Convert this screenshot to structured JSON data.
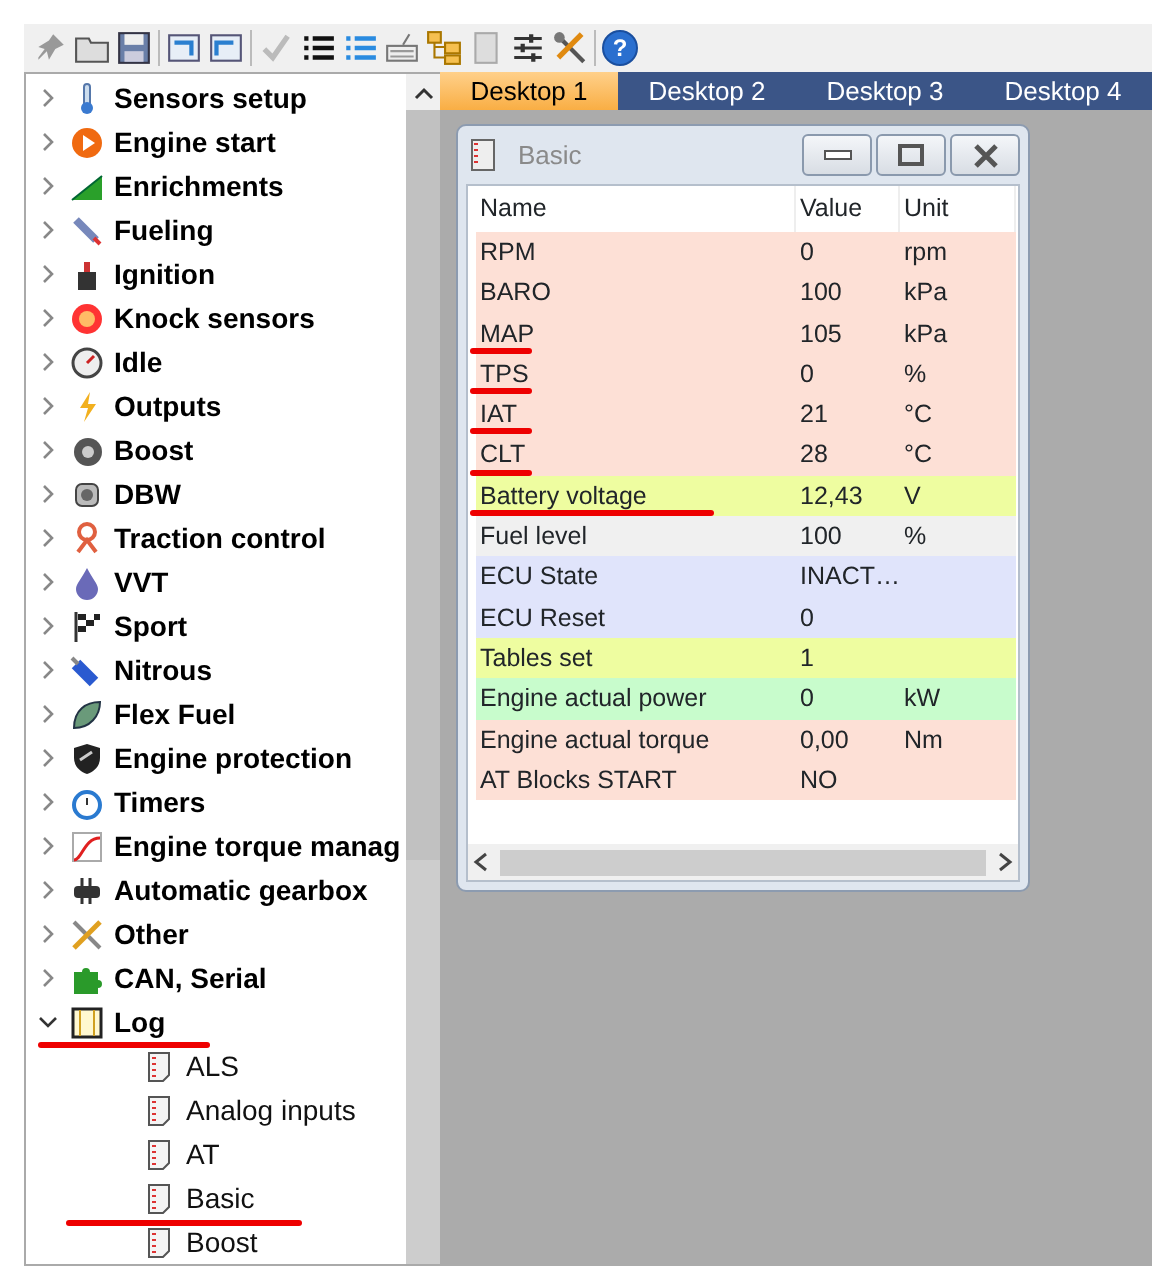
{
  "toolbar": {
    "help": "?"
  },
  "tabs": [
    {
      "label": "Desktop 1",
      "selected": true
    },
    {
      "label": "Desktop 2",
      "selected": false
    },
    {
      "label": "Desktop 3",
      "selected": false
    },
    {
      "label": "Desktop 4",
      "selected": false
    }
  ],
  "tree": [
    {
      "label": "Sensors setup",
      "expanded": false,
      "underlined": false
    },
    {
      "label": "Engine start",
      "expanded": false,
      "underlined": false
    },
    {
      "label": "Enrichments",
      "expanded": false,
      "underlined": false
    },
    {
      "label": "Fueling",
      "expanded": false,
      "underlined": false
    },
    {
      "label": "Ignition",
      "expanded": false,
      "underlined": false
    },
    {
      "label": "Knock sensors",
      "expanded": false,
      "underlined": false
    },
    {
      "label": "Idle",
      "expanded": false,
      "underlined": false
    },
    {
      "label": "Outputs",
      "expanded": false,
      "underlined": false
    },
    {
      "label": "Boost",
      "expanded": false,
      "underlined": false
    },
    {
      "label": "DBW",
      "expanded": false,
      "underlined": false
    },
    {
      "label": "Traction control",
      "expanded": false,
      "underlined": false
    },
    {
      "label": "VVT",
      "expanded": false,
      "underlined": false
    },
    {
      "label": "Sport",
      "expanded": false,
      "underlined": false
    },
    {
      "label": "Nitrous",
      "expanded": false,
      "underlined": false
    },
    {
      "label": "Flex Fuel",
      "expanded": false,
      "underlined": false
    },
    {
      "label": "Engine protection",
      "expanded": false,
      "underlined": false
    },
    {
      "label": "Timers",
      "expanded": false,
      "underlined": false
    },
    {
      "label": "Engine torque manag",
      "expanded": false,
      "underlined": false
    },
    {
      "label": "Automatic gearbox",
      "expanded": false,
      "underlined": false
    },
    {
      "label": "Other",
      "expanded": false,
      "underlined": false
    },
    {
      "label": "CAN, Serial",
      "expanded": false,
      "underlined": false
    },
    {
      "label": "Log",
      "expanded": true,
      "underlined": true,
      "children": [
        {
          "label": "ALS",
          "underlined": false
        },
        {
          "label": "Analog inputs",
          "underlined": false
        },
        {
          "label": "AT",
          "underlined": false
        },
        {
          "label": "Basic",
          "underlined": true
        },
        {
          "label": "Boost",
          "underlined": false
        }
      ]
    }
  ],
  "log_window": {
    "title": "Basic",
    "columns": [
      "Name",
      "Value",
      "Unit"
    ],
    "rows": [
      {
        "name": "RPM",
        "value": "0",
        "unit": "rpm",
        "color": "#fde0d6",
        "underlined": false
      },
      {
        "name": "BARO",
        "value": "100",
        "unit": "kPa",
        "color": "#fde0d6",
        "underlined": false
      },
      {
        "name": "MAP",
        "value": "105",
        "unit": "kPa",
        "color": "#fde0d6",
        "underlined": true
      },
      {
        "name": "TPS",
        "value": "0",
        "unit": "%",
        "color": "#fde0d6",
        "underlined": true
      },
      {
        "name": "IAT",
        "value": "21",
        "unit": "°C",
        "color": "#fde0d6",
        "underlined": true
      },
      {
        "name": "CLT",
        "value": "28",
        "unit": "°C",
        "color": "#fde0d6",
        "underlined": true
      },
      {
        "name": "Battery voltage",
        "value": "12,43",
        "unit": "V",
        "color": "#eefda0",
        "underlined": true
      },
      {
        "name": "Fuel level",
        "value": "100",
        "unit": "%",
        "color": "#f0f0f0",
        "underlined": false
      },
      {
        "name": "ECU State",
        "value": "INACT…",
        "unit": "",
        "color": "#e0e4fb",
        "underlined": false
      },
      {
        "name": "ECU Reset",
        "value": "0",
        "unit": "",
        "color": "#e0e4fb",
        "underlined": false
      },
      {
        "name": "Tables set",
        "value": "1",
        "unit": "",
        "color": "#eefda0",
        "underlined": false
      },
      {
        "name": "Engine actual power",
        "value": "0",
        "unit": "kW",
        "color": "#c8fccc",
        "underlined": false
      },
      {
        "name": "Engine actual torque",
        "value": "0,00",
        "unit": "Nm",
        "color": "#fde0d6",
        "underlined": false
      },
      {
        "name": "AT Blocks START",
        "value": "NO",
        "unit": "",
        "color": "#fde0d6",
        "underlined": false
      }
    ]
  }
}
